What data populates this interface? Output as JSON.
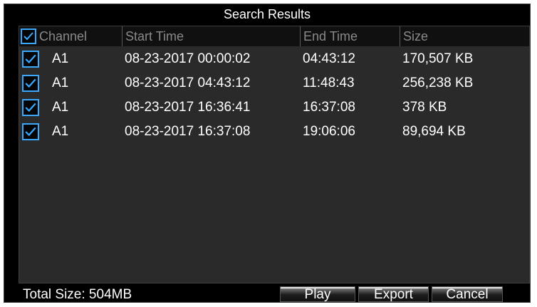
{
  "dialog": {
    "title": "Search Results"
  },
  "table": {
    "columns": {
      "channel": "Channel",
      "start_time": "Start Time",
      "end_time": "End Time",
      "size": "Size"
    },
    "rows": [
      {
        "checked": true,
        "channel": "A1",
        "start_time": "08-23-2017 00:00:02",
        "end_time": "04:43:12",
        "size": "170,507 KB"
      },
      {
        "checked": true,
        "channel": "A1",
        "start_time": "08-23-2017 04:43:12",
        "end_time": "11:48:43",
        "size": "256,238 KB"
      },
      {
        "checked": true,
        "channel": "A1",
        "start_time": "08-23-2017 16:36:41",
        "end_time": "16:37:08",
        "size": "378 KB"
      },
      {
        "checked": true,
        "channel": "A1",
        "start_time": "08-23-2017 16:37:08",
        "end_time": "19:06:06",
        "size": "89,694 KB"
      }
    ]
  },
  "footer": {
    "total_size": "Total Size: 504MB",
    "play_label": "Play",
    "export_label": "Export",
    "cancel_label": "Cancel"
  },
  "colors": {
    "accent": "#39a8ff",
    "background": "#000000",
    "list_background": "#2a2a2a"
  }
}
